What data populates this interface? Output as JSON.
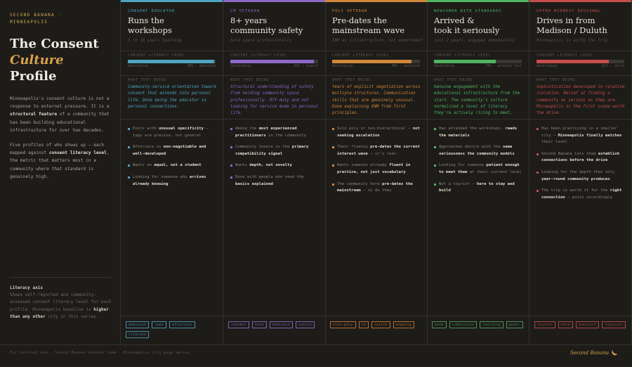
{
  "intro": {
    "brand_line_1": "SECOND BANANA ·",
    "brand_line_2": "MINNEAPOLIS",
    "title_line_1": "The Consent",
    "title_line_2": "Culture",
    "title_line_3": "Profile",
    "para_1_a": "Minneapolis's consent culture is not a response to external pressure. It is a ",
    "para_1_b": "structural feature",
    "para_1_c": " of a community that has been building educational infrastructure for over two decades.",
    "para_2_a": "Five profiles of who shows up — each mapped against ",
    "para_2_b": "consent literacy level",
    "para_2_c": ", the metric that matters most in a community where that standard is genuinely high.",
    "note_title": "Literacy axis",
    "note_a": "Shows self-reported and community-assessed consent literacy level for each profile. Minneapolis baseline is ",
    "note_b": "higher than any other",
    "note_c": " city in this series."
  },
  "columns": [
    {
      "eyebrow": "CONSENT EDUCATOR",
      "title_1": "Runs the",
      "title_2": "workshops",
      "sub": "5 to 10 years teaching",
      "meter_label": "CONSENT LITERACY LEVEL",
      "meter_left": "developing",
      "meter_right": "98% · advanced",
      "level": 0.98,
      "state_label": "WHAT THEY BRING",
      "state": "Community-service orientation toward consent that extends into personal life. Done being the educator in personal connections.",
      "points": [
        {
          "a": "Posts with ",
          "b": "unusual specificity",
          "c": " — tags are precise, not general"
        },
        {
          "a": "Aftercare is ",
          "b": "non-negotiable and well-developed",
          "c": ""
        },
        {
          "a": "Wants an ",
          "b": "equal, not a student",
          "c": ""
        },
        {
          "a": "Looking for someone who ",
          "b": "arrives already knowing",
          "c": ""
        }
      ],
      "tags": [
        "dominant",
        "rope",
        "aftercare",
        "literate"
      ],
      "color": "#4fa5bf",
      "tag_color": "#4a8ba0"
    },
    {
      "eyebrow": "CM VETERAN",
      "title_1": "8+ years",
      "title_2": "community safety",
      "sub": "held space professionally",
      "meter_label": "CONSENT LITERACY LEVEL",
      "meter_left": "developing",
      "meter_right": "95% · expert",
      "level": 0.95,
      "state_label": "WHAT THEY BRING",
      "state": "Structural understanding of safety from holding community space professionally. Off-duty and not looking for service mode in personal life.",
      "points": [
        {
          "a": "Among the ",
          "b": "most experienced practitioners",
          "c": " in the community"
        },
        {
          "a": "Community tenure is the ",
          "b": "primary compatibility signal",
          "c": ""
        },
        {
          "a": "Wants ",
          "b": "depth, not novelty",
          "c": ""
        },
        {
          "a": "Done with people who need the ",
          "b": "basics explained",
          "c": ""
        }
      ],
      "tags": [
        "leather",
        "BDSM",
        "dominant",
        "switch"
      ],
      "color": "#8d68c7",
      "tag_color": "#7c63aa"
    },
    {
      "eyebrow": "POLY VETERAN",
      "title_1": "Pre-dates the",
      "title_2": "mainstream wave",
      "sub": "ENM as infrastructure, not experiment",
      "meter_label": "CONSENT LITERACY LEVEL",
      "meter_left": "developing",
      "meter_right": "90% · advanced",
      "level": 0.9,
      "state_label": "WHAT THEY BRING",
      "state": "Years of explicit negotiation across multiple structures. Communication skills that are genuinely unusual. Done explaining ENM from first principles.",
      "points": [
        {
          "a": "Solo poly or non-hierarchical — ",
          "b": "not seeking escalation",
          "c": ""
        },
        {
          "a": "Their fluency ",
          "b": "pre-dates the current interest wave",
          "c": " — it's real"
        },
        {
          "a": "Wants someone already ",
          "b": "fluent in practice, not just vocabulary",
          "c": ""
        },
        {
          "a": "The community here ",
          "b": "pre-dates the mainstream",
          "c": " — so do they"
        }
      ],
      "tags": [
        "solo-poly",
        "RA",
        "switch",
        "ongoing"
      ],
      "color": "#d2873b",
      "tag_color": "#b26e34"
    },
    {
      "eyebrow": "NEWCOMER WITH STANDARDS",
      "title_1": "Arrived &",
      "title_2": "took it seriously",
      "sub": "last 2 years, engaged immediately",
      "meter_label": "CONSENT LITERACY LEVEL",
      "meter_left": "developing",
      "meter_right": "70% · growing fast",
      "level": 0.7,
      "state_label": "WHAT THEY BRING",
      "state": "Genuine engagement with the educational infrastructure from the start. The community's culture normalized a level of literacy they're actively rising to meet.",
      "points": [
        {
          "a": "Has attended the workshops, ",
          "b": "reads the materials",
          "c": ""
        },
        {
          "a": "Approaches desire with the ",
          "b": "same seriousness the community models",
          "c": ""
        },
        {
          "a": "Looking for someone ",
          "b": "patient enough to meet them",
          "c": " at their current level"
        },
        {
          "a": "Not a tourist — ",
          "b": "here to stay and build",
          "c": ""
        }
      ],
      "tags": [
        "BDSM",
        "submissive",
        "learning",
        "queer"
      ],
      "color": "#4fb45f",
      "tag_color": "#4c8f56"
    },
    {
      "eyebrow": "UPPER MIDWEST REGIONAL",
      "title_1": "Drives in from",
      "title_2": "Madison / Duluth",
      "sub": "Minneapolis is worth the trip",
      "meter_label": "CONSENT LITERACY LEVEL",
      "meter_left": "developing",
      "meter_right": "82% · solid",
      "level": 0.82,
      "state_label": "WHAT THEY BRING",
      "state": "Sophistication developed in relative isolation. Relief at finding a community as serious as they are. Minneapolis is the first scene worth the drive.",
      "points": [
        {
          "a": "Has been practicing in a smaller city — ",
          "b": "Minneapolis finally matches",
          "c": " their level"
        },
        {
          "a": "Second Banana lets them ",
          "b": "establish connections before the drive",
          "c": ""
        },
        {
          "a": "Looking for the depth that only ",
          "b": "year-round community produces",
          "c": ""
        },
        {
          "a": "The trip is worth it for the ",
          "b": "right connection",
          "c": " — posts accordingly"
        }
      ],
      "tags": [
        "leather",
        "BDSM",
        "dominant",
        "regional"
      ],
      "color": "#c74d4d",
      "tag_color": "#a94848"
    }
  ],
  "footer": {
    "note": "For internal use · Second Banana content team · Minneapolis city page series",
    "brand": "Second Banana"
  }
}
